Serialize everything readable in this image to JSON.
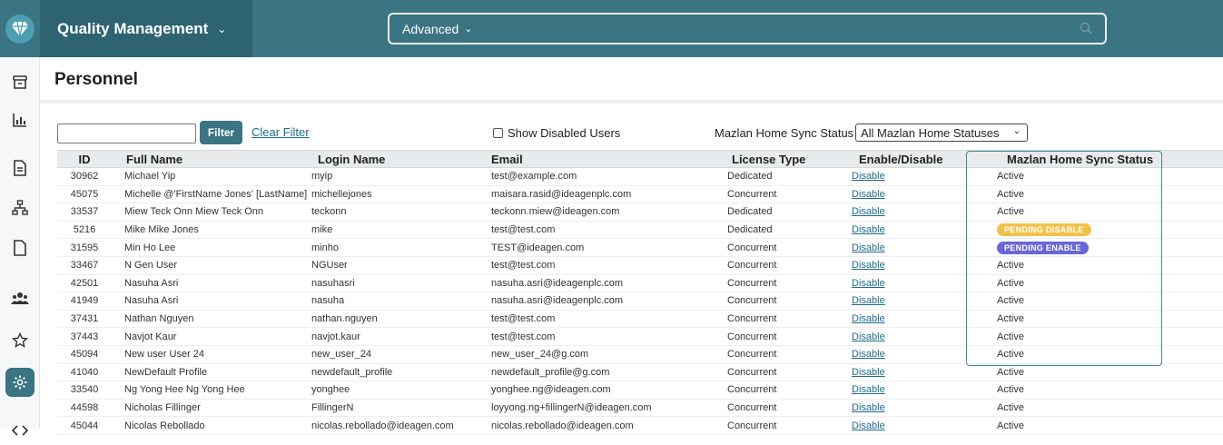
{
  "header": {
    "module_title": "Quality Management",
    "search_mode": "Advanced"
  },
  "page": {
    "title": "Personnel"
  },
  "filters": {
    "filter_value": "",
    "filter_button": "Filter",
    "clear_filter": "Clear Filter",
    "show_disabled_label": "Show Disabled Users",
    "sync_status_label": "Mazlan Home Sync Status",
    "sync_status_selected": "All Mazlan Home Statuses"
  },
  "table": {
    "columns": {
      "id": "ID",
      "full_name": "Full Name",
      "login_name": "Login Name",
      "email": "Email",
      "license_type": "License Type",
      "enable_disable": "Enable/Disable",
      "sync_status": "Mazlan Home Sync Status"
    },
    "rows": [
      {
        "id": "30962",
        "name": "Michael Yip",
        "login": "myip",
        "email": "test@example.com",
        "license": "Dedicated",
        "action": "Disable",
        "status": "Active"
      },
      {
        "id": "45075",
        "name": "Michelle @'FirstName Jones' [LastName]",
        "login": "michellejones",
        "email": "maisara.rasid@ideagenplc.com",
        "license": "Concurrent",
        "action": "Disable",
        "status": "Active"
      },
      {
        "id": "33537",
        "name": "Miew Teck Onn Miew Teck Onn",
        "login": "teckonn",
        "email": "teckonn.miew@ideagen.com",
        "license": "Dedicated",
        "action": "Disable",
        "status": "Active"
      },
      {
        "id": "5216",
        "name": "Mike Mike Jones",
        "login": "mike",
        "email": "test@test.com",
        "license": "Dedicated",
        "action": "Disable",
        "status": "PENDING DISABLE"
      },
      {
        "id": "31595",
        "name": "Min Ho Lee",
        "login": "minho",
        "email": "TEST@ideagen.com",
        "license": "Concurrent",
        "action": "Disable",
        "status": "PENDING ENABLE"
      },
      {
        "id": "33467",
        "name": "N Gen User",
        "login": "NGUser",
        "email": "test@test.com",
        "license": "Concurrent",
        "action": "Disable",
        "status": "Active"
      },
      {
        "id": "42501",
        "name": "Nasuha Asri",
        "login": "nasuhasri",
        "email": "nasuha.asri@ideagenplc.com",
        "license": "Concurrent",
        "action": "Disable",
        "status": "Active"
      },
      {
        "id": "41949",
        "name": "Nasuha Asri",
        "login": "nasuha",
        "email": "nasuha.asri@ideagenplc.com",
        "license": "Concurrent",
        "action": "Disable",
        "status": "Active"
      },
      {
        "id": "37431",
        "name": "Nathan Nguyen",
        "login": "nathan.nguyen",
        "email": "test@test.com",
        "license": "Concurrent",
        "action": "Disable",
        "status": "Active"
      },
      {
        "id": "37443",
        "name": "Navjot Kaur",
        "login": "navjot.kaur",
        "email": "test@test.com",
        "license": "Concurrent",
        "action": "Disable",
        "status": "Active"
      },
      {
        "id": "45094",
        "name": "New user User 24",
        "login": "new_user_24",
        "email": "new_user_24@g.com",
        "license": "Concurrent",
        "action": "Disable",
        "status": "Active"
      },
      {
        "id": "41040",
        "name": "NewDefault Profile",
        "login": "newdefault_profile",
        "email": "newdefault_profile@g.com",
        "license": "Concurrent",
        "action": "Disable",
        "status": "Active"
      },
      {
        "id": "33540",
        "name": "Ng Yong Hee Ng Yong Hee",
        "login": "yonghee",
        "email": "yonghee.ng@ideagen.com",
        "license": "Concurrent",
        "action": "Disable",
        "status": "Active"
      },
      {
        "id": "44598",
        "name": "Nicholas Fillinger",
        "login": "FillingerN",
        "email": "loyyong.ng+fillingerN@ideagen.com",
        "license": "Concurrent",
        "action": "Disable",
        "status": "Active"
      },
      {
        "id": "45044",
        "name": "Nicolas Rebollado",
        "login": "nicolas.rebollado@ideagen.com",
        "email": "nicolas.rebollado@ideagen.com",
        "license": "Concurrent",
        "action": "Disable",
        "status": "Active"
      }
    ]
  },
  "colors": {
    "brand": "#3b7483",
    "pending_disable": "#f1c24b",
    "pending_enable": "#6a67d6"
  }
}
